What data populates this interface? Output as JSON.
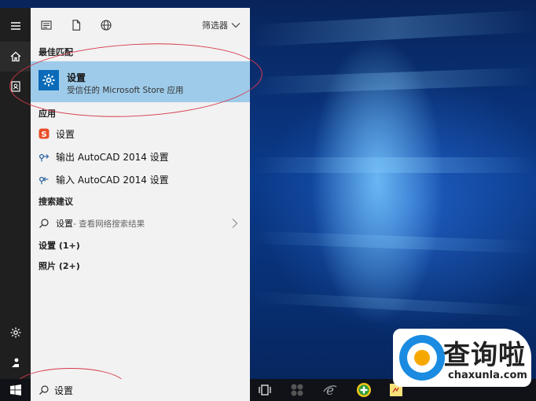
{
  "panel": {
    "filter_label": "筛选器",
    "best_match_title": "最佳匹配",
    "best_match": {
      "name": "设置",
      "subtitle": "受信任的 Microsoft Store 应用"
    },
    "apps_title": "应用",
    "apps": [
      {
        "label": "设置",
        "icon": "app-s-icon"
      },
      {
        "label": "输出 AutoCAD 2014 设置",
        "icon": "autocad-export-icon"
      },
      {
        "label": "输入 AutoCAD 2014 设置",
        "icon": "autocad-import-icon"
      }
    ],
    "suggestions_title": "搜索建议",
    "suggestion": {
      "label": "设置",
      "hint": " - 查看网络搜索结果"
    },
    "category_settings": "设置 (1+)",
    "category_photos": "照片 (2+)"
  },
  "taskbar": {
    "search_value": "设置"
  },
  "watermark": {
    "title": "查询啦",
    "url": "chaxunla.com"
  },
  "colors": {
    "accent": "#0b6bb8",
    "selected_row": "#9ecbea",
    "annotation": "#d6394a"
  }
}
